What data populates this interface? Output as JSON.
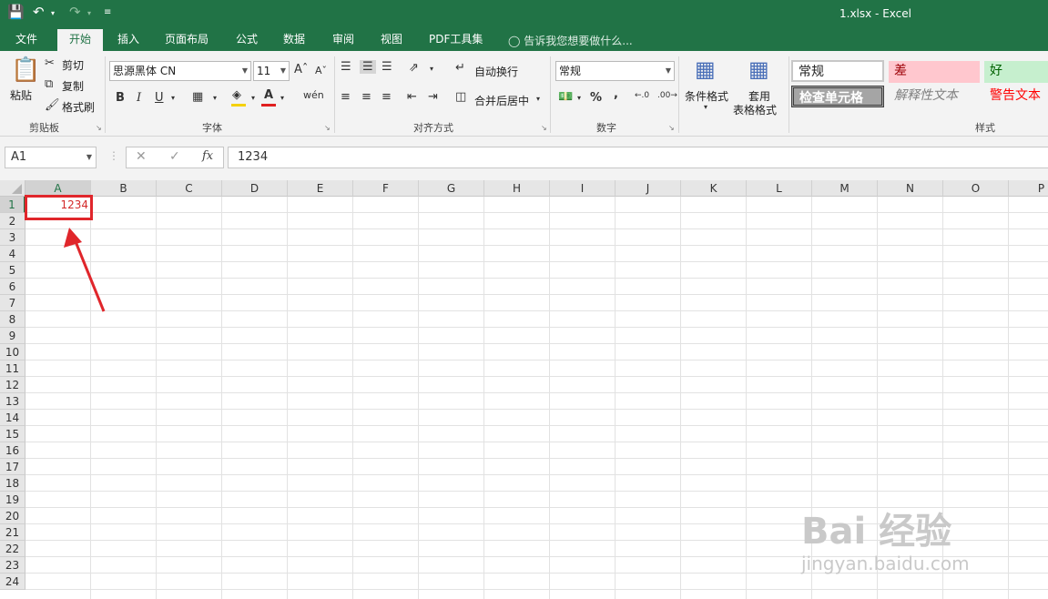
{
  "window": {
    "title": "1.xlsx  -  Excel"
  },
  "tabs": [
    {
      "label": "文件"
    },
    {
      "label": "开始"
    },
    {
      "label": "插入"
    },
    {
      "label": "页面布局"
    },
    {
      "label": "公式"
    },
    {
      "label": "数据"
    },
    {
      "label": "审阅"
    },
    {
      "label": "视图"
    },
    {
      "label": "PDF工具集"
    }
  ],
  "tell_me": "告诉我您想要做什么...",
  "ribbon": {
    "clipboard": {
      "paste": "粘贴",
      "cut": "剪切",
      "copy": "复制",
      "format_painter": "格式刷",
      "group": "剪贴板"
    },
    "font": {
      "name": "思源黑体 CN",
      "size": "11",
      "bold": "B",
      "italic": "I",
      "underline": "U",
      "group": "字体"
    },
    "alignment": {
      "wrap": "自动换行",
      "merge": "合并后居中",
      "group": "对齐方式"
    },
    "number": {
      "format": "常规",
      "percent": "%",
      "comma": ",",
      "group": "数字"
    },
    "styles": {
      "conditional": "条件格式",
      "table_format_1": "套用",
      "table_format_2": "表格格式",
      "normal": "常规",
      "bad": "差",
      "good": "好",
      "check_cell": "检查单元格",
      "explanatory": "解释性文本",
      "warning": "警告文本",
      "group": "样式"
    }
  },
  "formula_bar": {
    "name_box": "A1",
    "fx": "fx",
    "value": "1234"
  },
  "grid": {
    "columns": [
      "A",
      "B",
      "C",
      "D",
      "E",
      "F",
      "G",
      "H",
      "I",
      "J",
      "K",
      "L",
      "M",
      "N",
      "O",
      "P"
    ],
    "rows": [
      "1",
      "2",
      "3",
      "4",
      "5",
      "6",
      "7",
      "8",
      "9",
      "10",
      "11",
      "12",
      "13",
      "14",
      "15",
      "16",
      "17",
      "18",
      "19",
      "20",
      "21",
      "22",
      "23",
      "24"
    ],
    "cell_a1": "1234",
    "cell_a1_color": "#d32a2a"
  },
  "annotation_color": "#e0262b",
  "watermark": {
    "brand": "Bai 经验",
    "url": "jingyan.baidu.com"
  }
}
